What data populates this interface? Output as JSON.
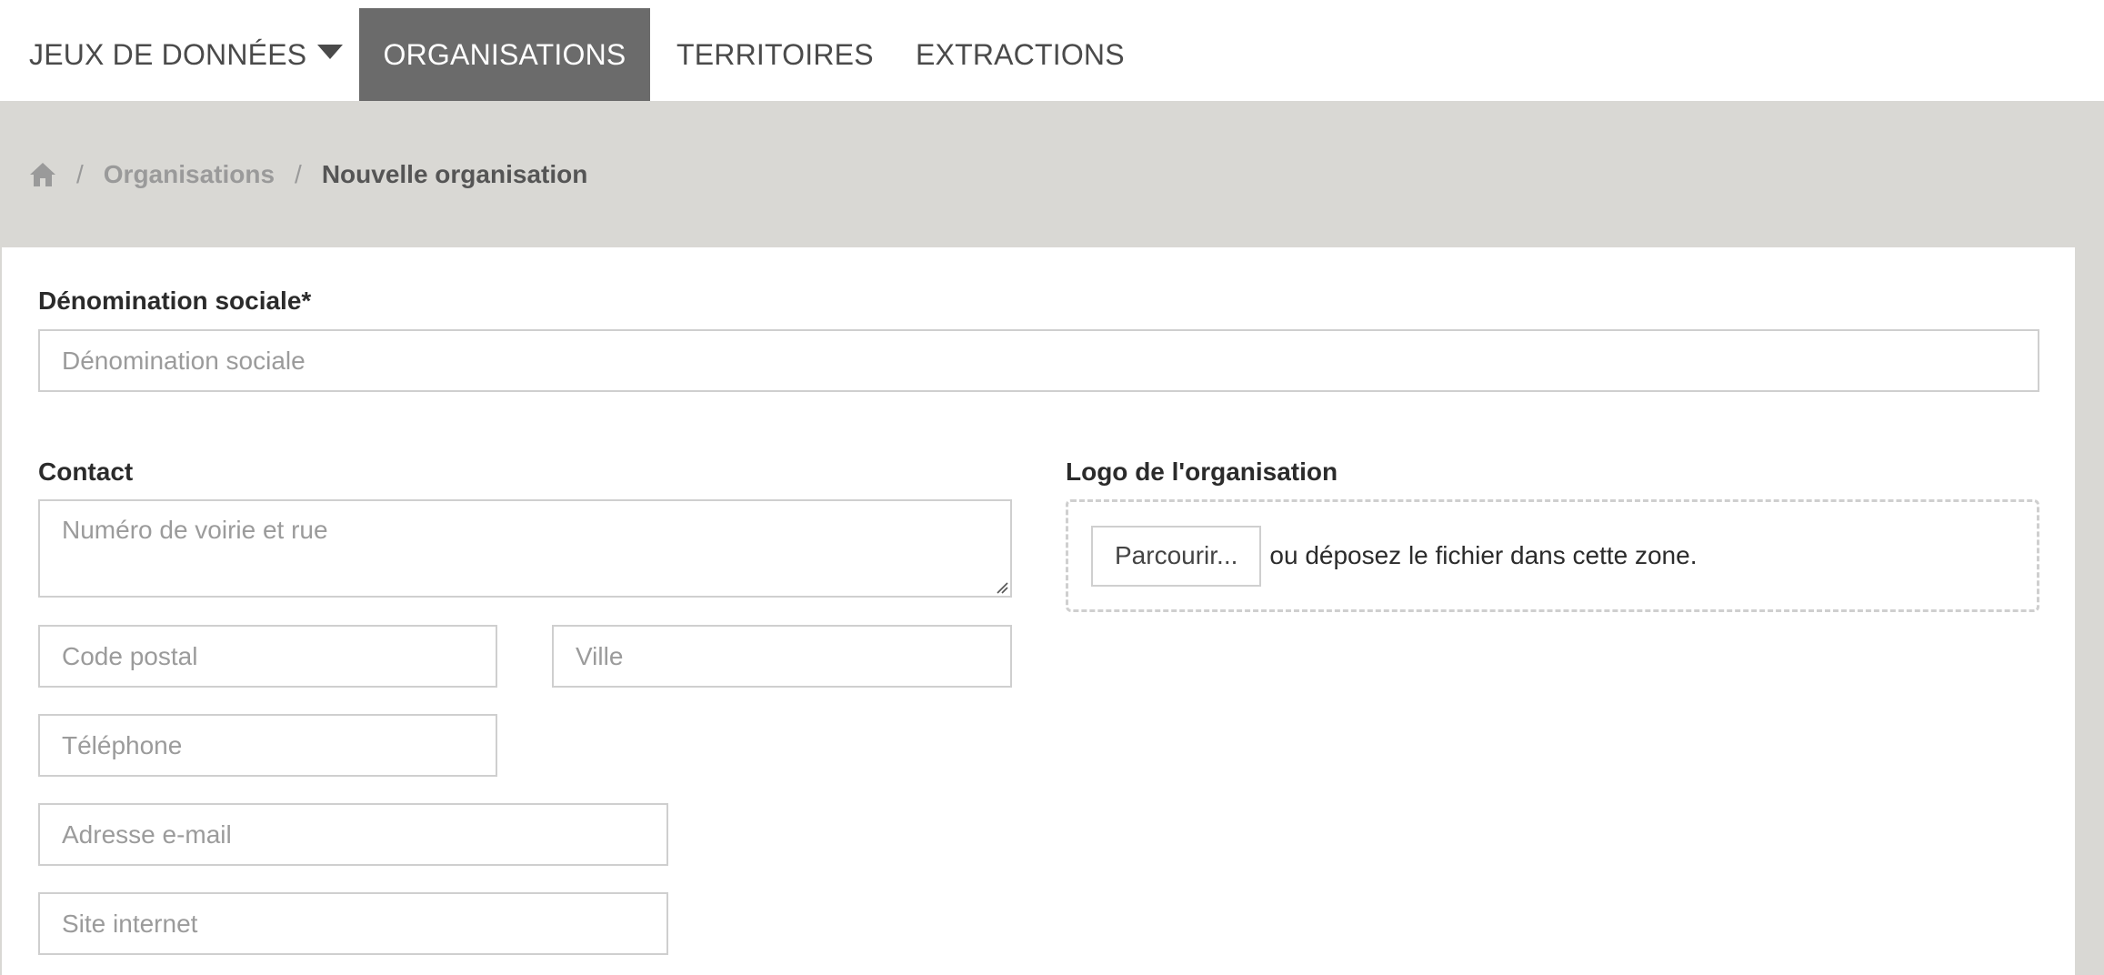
{
  "nav": {
    "datasets": "JEUX DE DONNÉES",
    "organisations": "ORGANISATIONS",
    "territories": "TERRITOIRES",
    "extractions": "EXTRACTIONS",
    "active": "organisations",
    "active_bg": "#6b6b6b"
  },
  "breadcrumb": {
    "home_icon": "home-icon",
    "separator": "/",
    "link": "Organisations",
    "current": "Nouvelle organisation"
  },
  "form": {
    "name_label": "Dénomination sociale*",
    "name_placeholder": "Dénomination sociale",
    "contact_label": "Contact",
    "street_placeholder": "Numéro de voirie et rue",
    "postal_placeholder": "Code postal",
    "city_placeholder": "Ville",
    "phone_placeholder": "Téléphone",
    "email_placeholder": "Adresse e-mail",
    "website_placeholder": "Site internet",
    "logo_label": "Logo de l'organisation",
    "browse_label": "Parcourir...",
    "drop_text": "ou déposez le fichier dans cette zone."
  }
}
